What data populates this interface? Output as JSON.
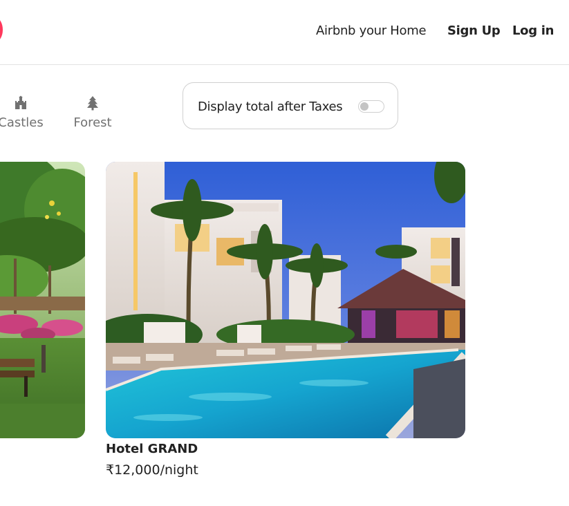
{
  "header": {
    "logo_icon": "airbnb-logo-icon",
    "host_link": "Airbnb your Home",
    "signup_link": "Sign Up",
    "login_link": "Log in"
  },
  "categories": [
    {
      "label": "Castles",
      "icon": "castle-icon"
    },
    {
      "label": "Forest",
      "icon": "tree-icon"
    }
  ],
  "tax_toggle": {
    "label": "Display total after Taxes",
    "enabled": false
  },
  "listings": [
    {
      "title": "",
      "price": "",
      "image": "garden-with-palm-trees-and-bench"
    },
    {
      "title": "Hotel GRAND",
      "price": "₹12,000/night",
      "image": "hotel-pool-with-palm-trees-at-dusk"
    }
  ],
  "colors": {
    "brand": "#ff385c",
    "text": "#222222",
    "muted": "#717171",
    "border": "#d0d0d0"
  }
}
